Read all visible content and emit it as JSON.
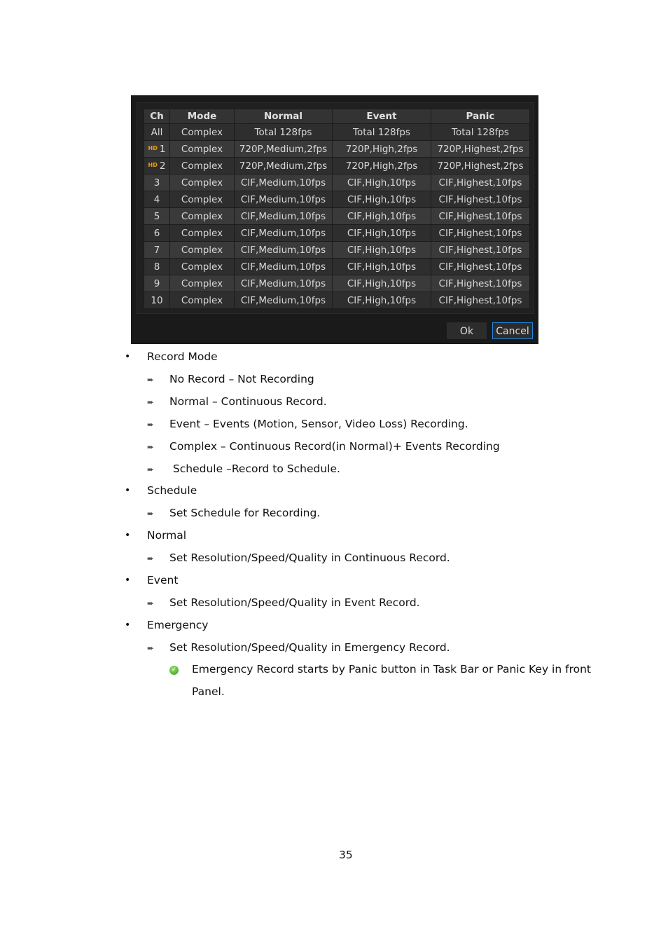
{
  "dialog": {
    "headers": [
      "Ch",
      "Mode",
      "Normal",
      "Event",
      "Panic"
    ],
    "hd_badge": "HD",
    "rows": [
      {
        "ch": "All",
        "hd": false,
        "mode": "Complex",
        "normal": "Total 128fps",
        "event": "Total 128fps",
        "panic": "Total 128fps"
      },
      {
        "ch": "1",
        "hd": true,
        "mode": "Complex",
        "normal": "720P,Medium,2fps",
        "event": "720P,High,2fps",
        "panic": "720P,Highest,2fps"
      },
      {
        "ch": "2",
        "hd": true,
        "mode": "Complex",
        "normal": "720P,Medium,2fps",
        "event": "720P,High,2fps",
        "panic": "720P,Highest,2fps"
      },
      {
        "ch": "3",
        "hd": false,
        "mode": "Complex",
        "normal": "CIF,Medium,10fps",
        "event": "CIF,High,10fps",
        "panic": "CIF,Highest,10fps"
      },
      {
        "ch": "4",
        "hd": false,
        "mode": "Complex",
        "normal": "CIF,Medium,10fps",
        "event": "CIF,High,10fps",
        "panic": "CIF,Highest,10fps"
      },
      {
        "ch": "5",
        "hd": false,
        "mode": "Complex",
        "normal": "CIF,Medium,10fps",
        "event": "CIF,High,10fps",
        "panic": "CIF,Highest,10fps"
      },
      {
        "ch": "6",
        "hd": false,
        "mode": "Complex",
        "normal": "CIF,Medium,10fps",
        "event": "CIF,High,10fps",
        "panic": "CIF,Highest,10fps"
      },
      {
        "ch": "7",
        "hd": false,
        "mode": "Complex",
        "normal": "CIF,Medium,10fps",
        "event": "CIF,High,10fps",
        "panic": "CIF,Highest,10fps"
      },
      {
        "ch": "8",
        "hd": false,
        "mode": "Complex",
        "normal": "CIF,Medium,10fps",
        "event": "CIF,High,10fps",
        "panic": "CIF,Highest,10fps"
      },
      {
        "ch": "9",
        "hd": false,
        "mode": "Complex",
        "normal": "CIF,Medium,10fps",
        "event": "CIF,High,10fps",
        "panic": "CIF,Highest,10fps"
      },
      {
        "ch": "10",
        "hd": false,
        "mode": "Complex",
        "normal": "CIF,Medium,10fps",
        "event": "CIF,High,10fps",
        "panic": "CIF,Highest,10fps"
      }
    ],
    "ok_label": "Ok",
    "cancel_label": "Cancel",
    "accent": "#1e88e5"
  },
  "doc": {
    "lines": [
      {
        "level": 1,
        "text": "Record Mode"
      },
      {
        "level": 2,
        "text": "No Record – Not Recording"
      },
      {
        "level": 2,
        "text": "Normal – Continuous Record."
      },
      {
        "level": 2,
        "text": "Event – Events (Motion, Sensor, Video Loss) Recording."
      },
      {
        "level": 2,
        "text": "Complex – Continuous Record(in Normal)+ Events Recording"
      },
      {
        "level": 2,
        "text": " Schedule –Record to Schedule."
      },
      {
        "level": 1,
        "text": "Schedule"
      },
      {
        "level": 2,
        "text": "Set Schedule for Recording."
      },
      {
        "level": 1,
        "text": "Normal"
      },
      {
        "level": 2,
        "text": "Set Resolution/Speed/Quality in Continuous Record."
      },
      {
        "level": 1,
        "text": "Event"
      },
      {
        "level": 2,
        "text": "Set Resolution/Speed/Quality in Event Record."
      },
      {
        "level": 1,
        "text": "Emergency"
      },
      {
        "level": 2,
        "text": "Set Resolution/Speed/Quality in Emergency Record."
      },
      {
        "level": 3,
        "text": "Emergency Record starts by Panic button in Task Bar or Panic Key in front"
      },
      {
        "level": 4,
        "text": "Panel."
      }
    ],
    "page_number": "35"
  }
}
